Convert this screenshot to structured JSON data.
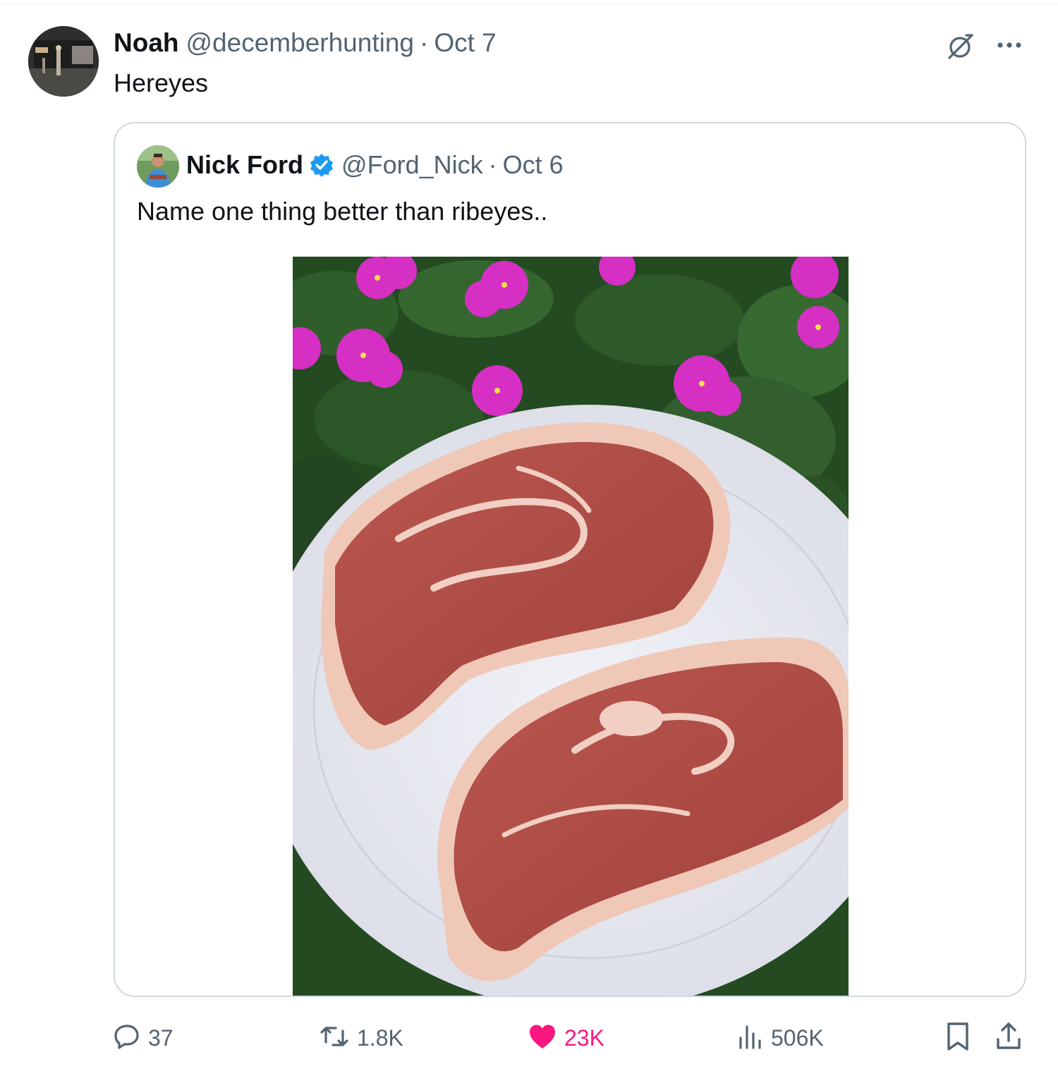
{
  "post": {
    "author_name": "Noah",
    "author_handle": "@decemberhunting",
    "separator": "·",
    "date": "Oct 7",
    "text": "Hereyes"
  },
  "quoted": {
    "author_name": "Nick Ford",
    "verified": true,
    "author_handle": "@Ford_Nick",
    "separator": "·",
    "date": "Oct 6",
    "text": "Name one thing better than ribeyes.."
  },
  "actions": {
    "replies": "37",
    "reposts": "1.8K",
    "likes": "23K",
    "views": "506K",
    "liked": true
  },
  "colors": {
    "text": "#0f1419",
    "secondary": "#536471",
    "like": "#f91880",
    "verified": "#1d9bf0",
    "border": "#cfd9de"
  },
  "icons": [
    "grok-icon",
    "more-icon",
    "verified-badge-icon",
    "reply-icon",
    "retweet-icon",
    "heart-icon",
    "views-icon",
    "bookmark-icon",
    "share-icon"
  ]
}
